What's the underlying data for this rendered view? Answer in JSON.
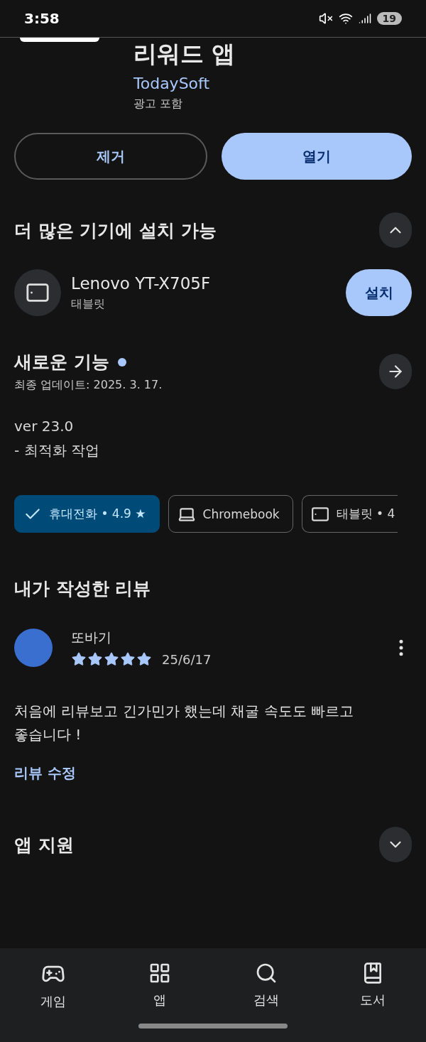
{
  "status_bar": {
    "time": "3:58",
    "battery": "19"
  },
  "app": {
    "title": "리워드 앱",
    "developer": "TodaySoft",
    "ads_note": "광고 포함"
  },
  "actions": [
    {
      "label": "제거",
      "kind": "outline"
    },
    {
      "label": "열기",
      "kind": "filled"
    }
  ],
  "more_devices": {
    "title": "더 많은 기기에 설치 가능",
    "expanded": true,
    "device": {
      "name": "Lenovo YT-X705F",
      "type": "태블릿",
      "button": "설치"
    }
  },
  "whats_new": {
    "title": "새로운 기능",
    "updated": "최종 업데이트: 2025. 3. 17.",
    "lines": [
      "ver 23.0",
      "- 최적화 작업"
    ]
  },
  "device_chips": [
    {
      "label": "휴대전화 • 4.9 ★",
      "kind": "phone",
      "selected": true
    },
    {
      "label": "Chromebook",
      "kind": "laptop",
      "selected": false
    },
    {
      "label": "태블릿 • 4",
      "kind": "tablet",
      "selected": false
    }
  ],
  "my_review": {
    "title": "내가 작성한 리뷰",
    "author": "또바기",
    "stars": 5,
    "date": "25/6/17",
    "text": "처음에 리뷰보고 긴가민가 했는데 채굴 속도도 빠르고 좋습니다 !",
    "edit_link": "리뷰 수정"
  },
  "app_support": {
    "title": "앱 지원",
    "expanded": false
  },
  "bottom_nav": [
    {
      "label": "게임",
      "kind": "games"
    },
    {
      "label": "앱",
      "kind": "apps"
    },
    {
      "label": "검색",
      "kind": "search"
    },
    {
      "label": "도서",
      "kind": "books"
    }
  ]
}
